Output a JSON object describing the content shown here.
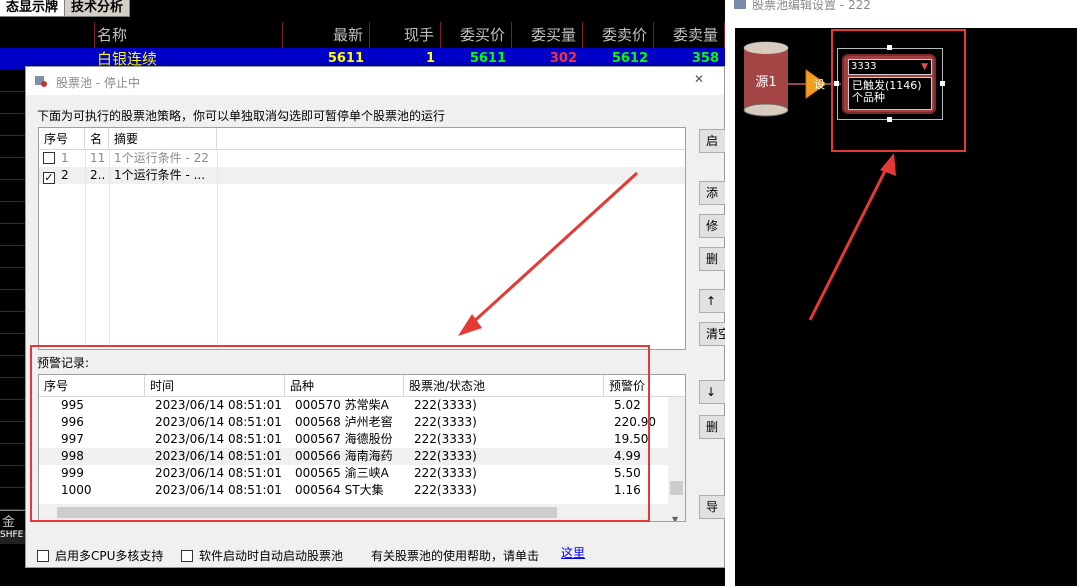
{
  "board": {
    "tabs": [
      "态显示牌",
      "技术分析"
    ],
    "columns": [
      "名称",
      "最新",
      "现手",
      "委买价",
      "委买量",
      "委卖价",
      "委卖量"
    ],
    "row": {
      "name": "白银连续",
      "last": "5611",
      "vol": "1",
      "bid": "5611",
      "bid_vol": "302",
      "ask": "5612",
      "ask_vol": "358"
    },
    "bottom_label": "金",
    "bottom_label2": "SHFE"
  },
  "dialog": {
    "title": "股票池  -  停止中",
    "description": "下面为可执行的股票池策略，你可以单独取消勾选即可暂停单个股票池的运行",
    "strategies": {
      "columns": [
        "序号",
        "名",
        "摘要"
      ],
      "rows": [
        {
          "checked": false,
          "no": "1",
          "name": "11",
          "summary": "1个运行条件 - 22",
          "dim": true
        },
        {
          "checked": true,
          "no": "2",
          "name": "2..",
          "summary": "1个运行条件 - ...",
          "dim": false
        }
      ]
    },
    "side_buttons": [
      "启",
      "添",
      "修",
      "删",
      "↑",
      "清空",
      "↓",
      "删",
      "导"
    ],
    "alert_label": "预警记录:",
    "alerts": {
      "columns": [
        "序号",
        "时间",
        "品种",
        "股票池/状态池",
        "预警价"
      ],
      "rows": [
        {
          "no": "995",
          "time": "2023/06/14 08:51:01",
          "symbol": "000570 苏常柴A",
          "pool": "222(3333)",
          "price": "5.02"
        },
        {
          "no": "996",
          "time": "2023/06/14 08:51:01",
          "symbol": "000568 泸州老窖",
          "pool": "222(3333)",
          "price": "220.90"
        },
        {
          "no": "997",
          "time": "2023/06/14 08:51:01",
          "symbol": "000567 海德股份",
          "pool": "222(3333)",
          "price": "19.50"
        },
        {
          "no": "998",
          "time": "2023/06/14 08:51:01",
          "symbol": "000566 海南海药",
          "pool": "222(3333)",
          "price": "4.99"
        },
        {
          "no": "999",
          "time": "2023/06/14 08:51:01",
          "symbol": "000565 渝三峡A",
          "pool": "222(3333)",
          "price": "5.50"
        },
        {
          "no": "1000",
          "time": "2023/06/14 08:51:01",
          "symbol": "000564 ST大集",
          "pool": "222(3333)",
          "price": "1.16"
        }
      ]
    },
    "options": {
      "multi_cpu": "启用多CPU多核支持",
      "auto_start": "软件启动时自动启动股票池"
    },
    "help_text": "有关股票池的使用帮助，请单击",
    "help_link": "这里"
  },
  "editor": {
    "title": "股票池编辑设置 - 222",
    "source_label": "源1",
    "trigger_label": "设",
    "node_title": "3333",
    "node_line1": "已触发(1146)",
    "node_line2": "个品种"
  },
  "colors": {
    "annotation": "#e53935",
    "row_highlight": "#0000c8",
    "price_yellow": "#ffff00",
    "price_red": "#ff3030",
    "price_green": "#00ff00"
  }
}
